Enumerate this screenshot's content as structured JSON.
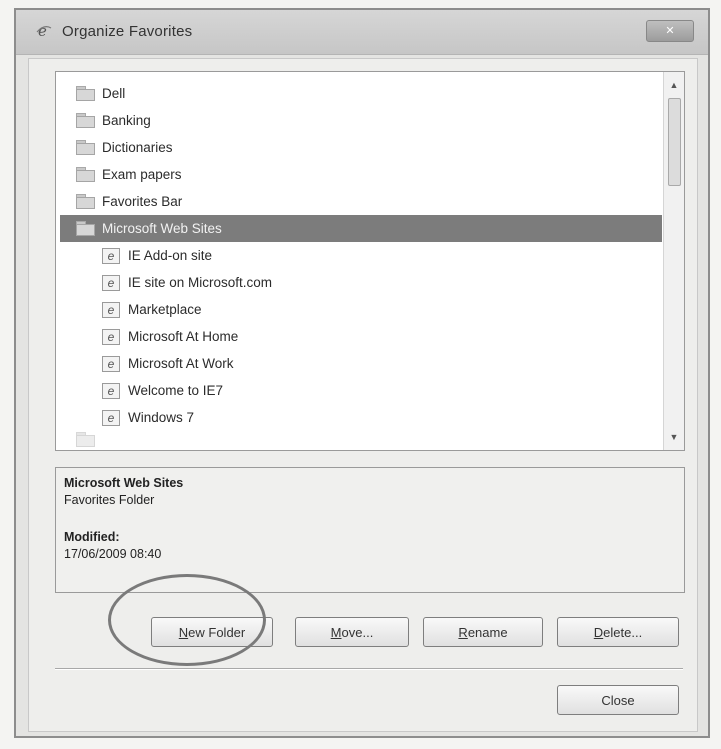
{
  "window": {
    "title": "Organize Favorites",
    "close_label": "Close"
  },
  "tree": {
    "items": [
      {
        "label": "Dell",
        "type": "folder"
      },
      {
        "label": "Banking",
        "type": "folder"
      },
      {
        "label": "Dictionaries",
        "type": "folder"
      },
      {
        "label": "Exam papers",
        "type": "folder"
      },
      {
        "label": "Favorites Bar",
        "type": "folder"
      },
      {
        "label": "Microsoft Web Sites",
        "type": "folder",
        "selected": true
      },
      {
        "label": "IE Add-on site",
        "type": "link"
      },
      {
        "label": "IE site on Microsoft.com",
        "type": "link"
      },
      {
        "label": "Marketplace",
        "type": "link"
      },
      {
        "label": "Microsoft At Home",
        "type": "link"
      },
      {
        "label": "Microsoft At Work",
        "type": "link"
      },
      {
        "label": "Welcome to IE7",
        "type": "link"
      },
      {
        "label": "Windows 7",
        "type": "link"
      }
    ]
  },
  "details": {
    "name": "Microsoft Web Sites",
    "kind": "Favorites Folder",
    "modified_label": "Modified:",
    "modified_value": "17/06/2009 08:40"
  },
  "buttons": {
    "new_folder": {
      "mnemonic": "N",
      "rest": "ew Folder"
    },
    "move": {
      "mnemonic": "M",
      "rest": "ove..."
    },
    "rename": {
      "mnemonic": "R",
      "rest": "ename"
    },
    "delete": {
      "mnemonic": "D",
      "rest": "elete..."
    },
    "close": "Close"
  },
  "icons": {
    "title": "ie-icon",
    "folder": "folder-icon",
    "link": "ie-link-icon"
  },
  "colors": {
    "selection": "#7c7c7c",
    "annotation_ring": "#7a7a7a"
  }
}
